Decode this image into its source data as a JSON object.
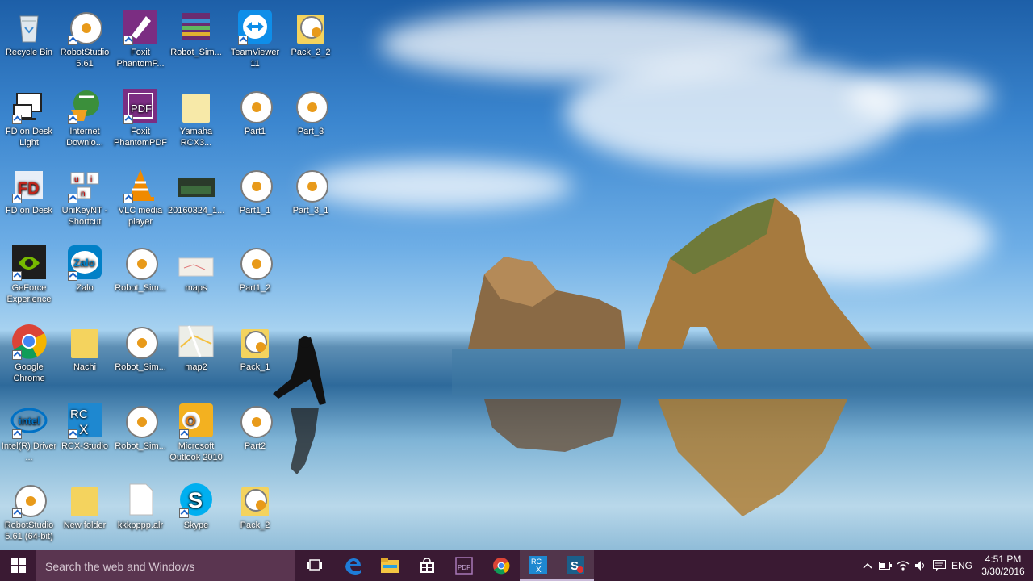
{
  "desktop_icons": [
    {
      "label": "Recycle Bin"
    },
    {
      "label": "RobotStudio 5.61"
    },
    {
      "label": "Foxit PhantomP..."
    },
    {
      "label": "Robot_Sim..."
    },
    {
      "label": "TeamViewer 11"
    },
    {
      "label": "Pack_2_2"
    },
    {
      "label": "FD on Desk Light"
    },
    {
      "label": "Internet Downlo..."
    },
    {
      "label": "Foxit PhantomPDF"
    },
    {
      "label": "Yamaha RCX3..."
    },
    {
      "label": "Part1"
    },
    {
      "label": "Part_3"
    },
    {
      "label": "FD on Desk"
    },
    {
      "label": "UniKeyNT - Shortcut"
    },
    {
      "label": "VLC media player"
    },
    {
      "label": "20160324_1..."
    },
    {
      "label": "Part1_1"
    },
    {
      "label": "Part_3_1"
    },
    {
      "label": "GeForce Experience"
    },
    {
      "label": "Zalo"
    },
    {
      "label": "Robot_Sim..."
    },
    {
      "label": "maps"
    },
    {
      "label": "Part1_2"
    },
    {
      "label": "Google Chrome"
    },
    {
      "label": "Nachi"
    },
    {
      "label": "Robot_Sim..."
    },
    {
      "label": "map2"
    },
    {
      "label": "Pack_1"
    },
    {
      "label": "Intel(R) Driver ..."
    },
    {
      "label": "RCX-Studio"
    },
    {
      "label": "Robot_Sim..."
    },
    {
      "label": "Microsoft Outlook 2010"
    },
    {
      "label": "Part2"
    },
    {
      "label": "RobotStudio 5.61 (64-bit)"
    },
    {
      "label": "New folder"
    },
    {
      "label": "kkkpppp.alr"
    },
    {
      "label": "Skype"
    },
    {
      "label": "Pack_2"
    }
  ],
  "taskbar": {
    "search_placeholder": "Search the web and Windows",
    "language": "ENG",
    "time": "4:51 PM",
    "date": "3/30/2016"
  }
}
